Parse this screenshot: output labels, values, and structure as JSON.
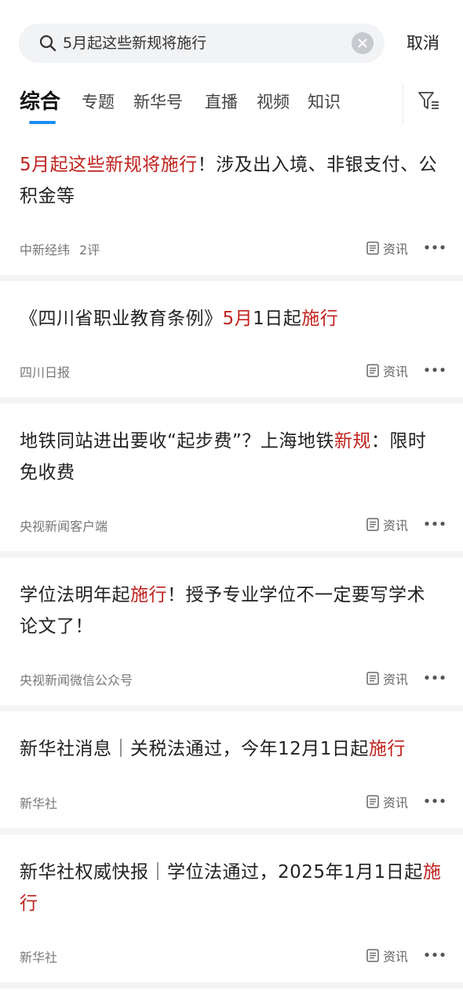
{
  "search": {
    "query": "5月起这些新规将施行",
    "cancel_label": "取消"
  },
  "tabs": [
    {
      "label": "综合",
      "active": true
    },
    {
      "label": "专题"
    },
    {
      "label": "新华号"
    },
    {
      "label": "直播"
    },
    {
      "label": "视频"
    },
    {
      "label": "知识"
    }
  ],
  "articles": [
    {
      "title_segments": [
        {
          "t": "5月起这些新规将施行",
          "hl": true
        },
        {
          "t": "！涉及出入境、非银支付、公积金等",
          "hl": false
        }
      ],
      "source": "中新经纬",
      "comments": "2评",
      "type": "资讯"
    },
    {
      "title_segments": [
        {
          "t": "《四川省职业教育条例》",
          "hl": false
        },
        {
          "t": "5月",
          "hl": true
        },
        {
          "t": "1日",
          "hl": false
        },
        {
          "t": "起",
          "hl": false
        },
        {
          "t": "施行",
          "hl": true
        }
      ],
      "source": "四川日报",
      "type": "资讯"
    },
    {
      "title_segments": [
        {
          "t": "地铁同站进出要收“起步费”？上海地铁",
          "hl": false
        },
        {
          "t": "新规",
          "hl": true
        },
        {
          "t": "：限时免收费",
          "hl": false
        }
      ],
      "source": "央视新闻客户端",
      "type": "资讯"
    },
    {
      "title_segments": [
        {
          "t": "学位法明年起",
          "hl": false
        },
        {
          "t": "施行",
          "hl": true
        },
        {
          "t": "！授予专业学位不一定要写学术论文了！",
          "hl": false
        }
      ],
      "source": "央视新闻微信公众号",
      "type": "资讯"
    },
    {
      "title_segments": [
        {
          "t": "新华社消息｜关税法通过，今年12月1日起",
          "hl": false
        },
        {
          "t": "施行",
          "hl": true
        }
      ],
      "source": "新华社",
      "type": "资讯"
    },
    {
      "title_segments": [
        {
          "t": "新华社权威快报｜学位法通过，2025年1月1日起",
          "hl": false
        },
        {
          "t": "施行",
          "hl": true
        }
      ],
      "source": "新华社",
      "type": "资讯"
    }
  ],
  "colors": {
    "highlight": "#c0221e",
    "tab_indicator": "#1a8cf0"
  },
  "icons": {
    "search": "search-icon",
    "clear": "clear-icon",
    "filter": "filter-icon",
    "doc": "document-icon",
    "more": "more-icon"
  }
}
